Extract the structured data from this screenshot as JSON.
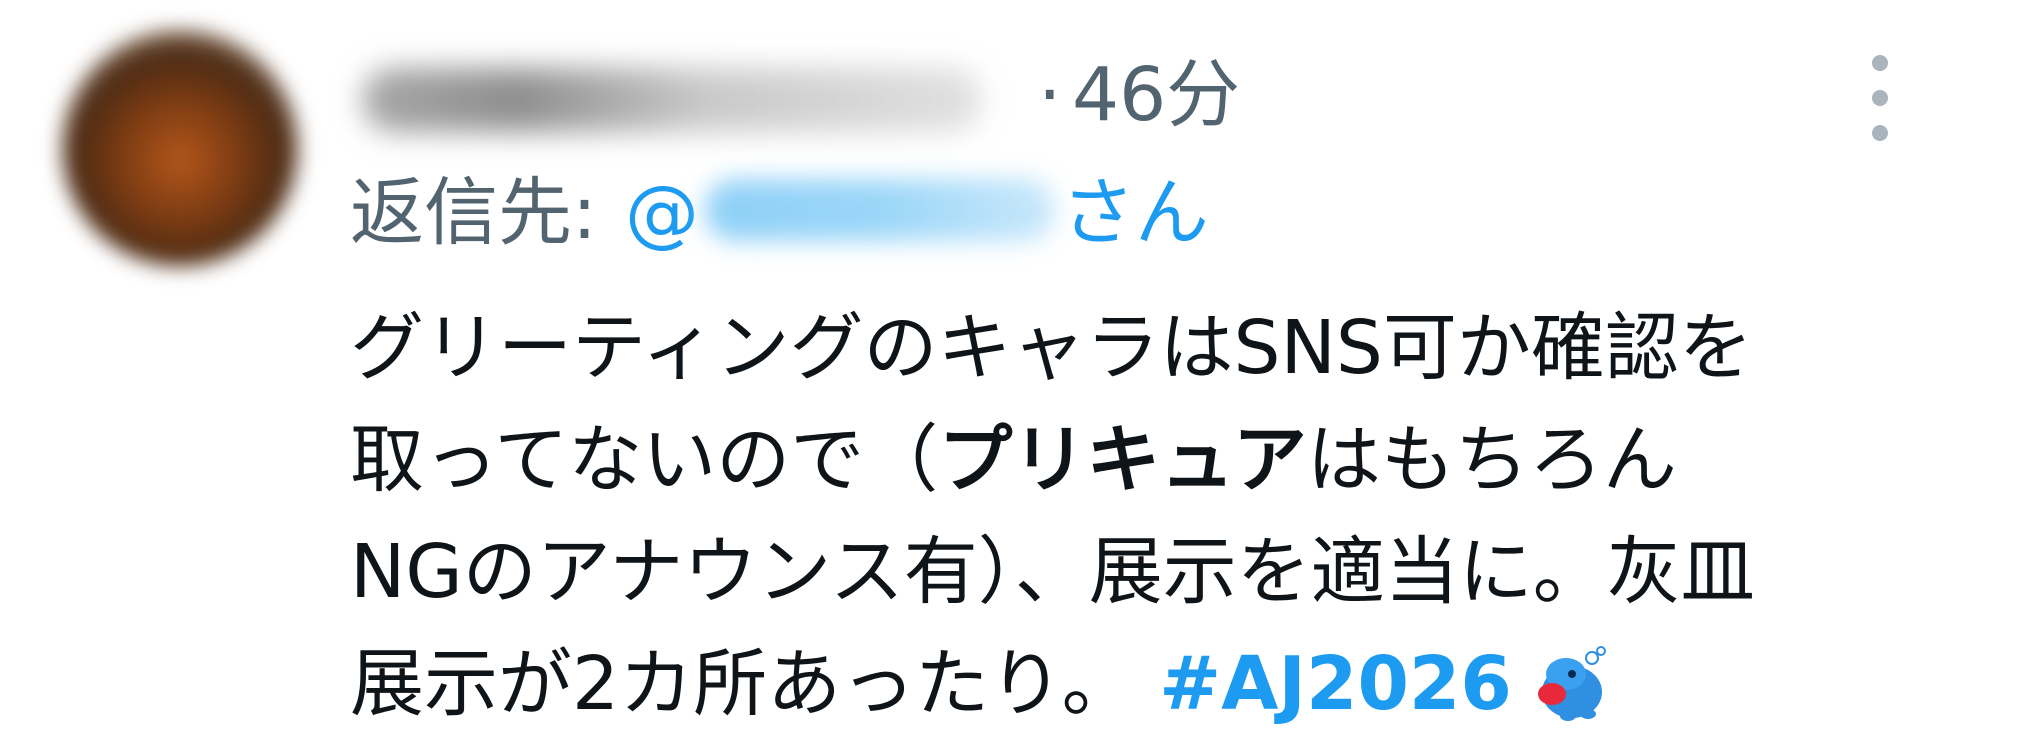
{
  "tweet": {
    "time": "46分",
    "separator": "·",
    "reply": {
      "label": "返信先:",
      "at": "@",
      "suffix": "さん"
    },
    "body": {
      "line1": "グリーティングのキャラはSNS可か確認を",
      "line2_pre": "取ってないので（",
      "line2_bold": "プリキュア",
      "line2_post": "はもちろん",
      "line3": "NGのアナウンス有）、展示を適当に。灰皿",
      "line4": "展示が2カ所あったり。",
      "hashtag": "#AJ2026"
    },
    "icons": {
      "avatar": "avatar-image",
      "more": "more-vertical-icon",
      "emoji": "hashtag-mascot-emoji"
    },
    "colors": {
      "link": "#1d9bf0",
      "secondary": "#536471",
      "text": "#0f1419"
    }
  }
}
